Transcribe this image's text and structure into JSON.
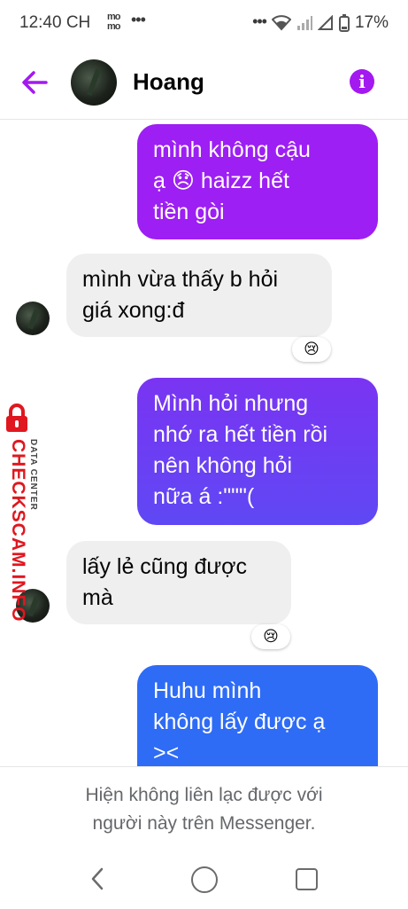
{
  "status_bar": {
    "time": "12:40 CH",
    "momo_top": "mo",
    "momo_bottom": "mo",
    "left_dots": "•••",
    "right_dots": "•••",
    "battery": "17%"
  },
  "header": {
    "contact_name": "Hoang",
    "info_label": "i"
  },
  "messages": [
    {
      "direction": "outgoing",
      "lines": [
        "mình không cậu",
        "ạ 😞 haizz hết",
        "tiền gòi"
      ]
    },
    {
      "direction": "incoming",
      "lines": [
        "mình vừa thấy b hỏi",
        "giá xong:đ"
      ],
      "reaction": "😢"
    },
    {
      "direction": "outgoing",
      "lines": [
        "Mình hỏi nhưng",
        "nhớ ra hết tiền rồi",
        "nên không hỏi",
        "nữa á :\"\"\"("
      ]
    },
    {
      "direction": "incoming",
      "lines": [
        "lấy lẻ cũng được",
        "mà"
      ],
      "reaction": "😢"
    },
    {
      "direction": "outgoing",
      "lines": [
        "Huhu mình",
        "không lấy được ạ",
        "><"
      ]
    }
  ],
  "watermark": {
    "main": "CHECKSCAM.INFO",
    "sub": "DATA CENTER"
  },
  "footer": {
    "line1": "Hiện không liên lạc được với",
    "line2": "người này trên Messenger."
  },
  "colors": {
    "accent": "#a319f0",
    "bubble_1": "#9d1ff3",
    "bubble_2": "#6b3cf3",
    "bubble_3": "#2e6cf6",
    "incoming_bg": "#efefef"
  }
}
